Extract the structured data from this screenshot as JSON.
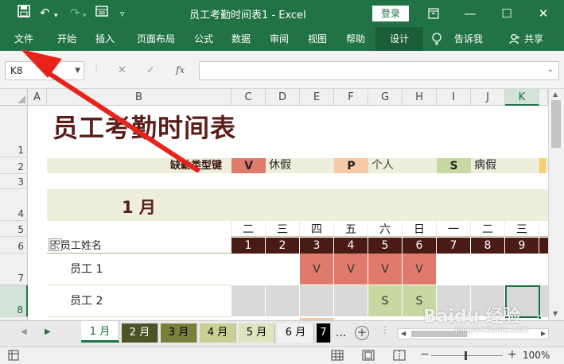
{
  "window": {
    "title": "员工考勤时间表1  -  Excel",
    "login_label": "登录"
  },
  "ribbon": {
    "tabs": [
      "文件",
      "开始",
      "插入",
      "页面布局",
      "公式",
      "数据",
      "审阅",
      "视图",
      "帮助",
      "设计"
    ],
    "tell_me": "告诉我",
    "share": "共享"
  },
  "formula_bar": {
    "name_box": "K8",
    "fx": "fx",
    "formula": ""
  },
  "grid": {
    "columns": [
      "A",
      "B",
      "C",
      "D",
      "E",
      "F",
      "G",
      "H",
      "I",
      "J",
      "K"
    ],
    "selected_column": "K",
    "rows": [
      "1",
      "2",
      "3",
      "4",
      "5",
      "6",
      "7",
      "8"
    ],
    "selected_row": "8",
    "title": "员工考勤时间表",
    "legend": {
      "label": "缺勤类型键",
      "items": [
        {
          "code": "V",
          "text": "休假",
          "color": "#e07a6c"
        },
        {
          "code": "P",
          "text": "个人",
          "color": "#f6c9a8"
        },
        {
          "code": "S",
          "text": "病假",
          "color": "#c6d9a2"
        }
      ]
    },
    "month": "1 月",
    "weekdays": [
      "二",
      "三",
      "四",
      "五",
      "六",
      "日",
      "一",
      "二",
      "三"
    ],
    "days": [
      "1",
      "2",
      "3",
      "4",
      "5",
      "6",
      "7",
      "8",
      "9"
    ],
    "name_header": "员工姓名",
    "employees": [
      {
        "name": "员工 1",
        "marks": [
          "",
          "",
          "V",
          "V",
          "V",
          "V",
          "",
          "",
          ""
        ]
      },
      {
        "name": "员工 2",
        "marks": [
          "",
          "",
          "",
          "",
          "S",
          "S",
          "",
          "",
          ""
        ]
      }
    ],
    "colors": {
      "header_dark": "#4a1a14",
      "band": "#eeeedd",
      "title_color": "#5a1e18",
      "weekend": "#d9d9d9",
      "selection": "#217346"
    }
  },
  "sheet_tabs": [
    {
      "label": "1 月",
      "bg": "#ffffff",
      "fg": "#1d6b3f",
      "active": true
    },
    {
      "label": "2 月",
      "bg": "#4d5324",
      "fg": "#ffffff"
    },
    {
      "label": "3 月",
      "bg": "#7a7f3c",
      "fg": "#000000"
    },
    {
      "label": "4 月",
      "bg": "#c9cf95",
      "fg": "#000000"
    },
    {
      "label": "5 月",
      "bg": "#dfe3c0",
      "fg": "#000000"
    },
    {
      "label": "6 月",
      "bg": "#f2f2f2",
      "fg": "#000000"
    },
    {
      "label": "7",
      "bg": "#000000",
      "fg": "#ffffff"
    }
  ],
  "sheet_more": "...",
  "status": {
    "zoom": "100%",
    "watermark": "Baidu 经验",
    "watermark_url": "jingyan.baidu.com"
  }
}
